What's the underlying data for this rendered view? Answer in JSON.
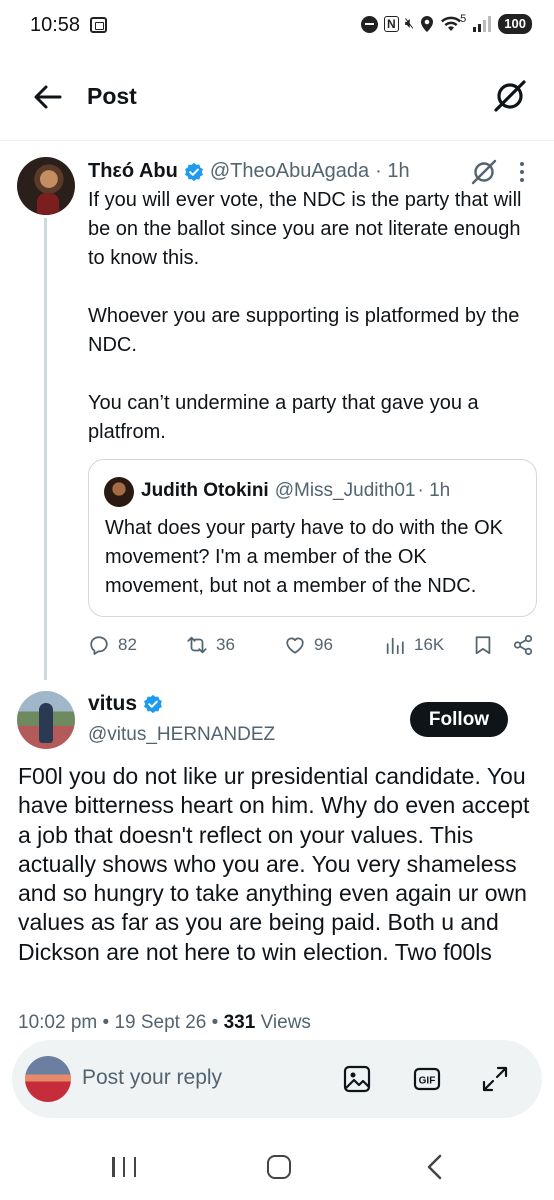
{
  "status_bar": {
    "time": "10:58",
    "network": "5",
    "battery": "100"
  },
  "header": {
    "title": "Post"
  },
  "parent_tweet": {
    "author_name": "Thεó Abu",
    "handle": "@TheoAbuAgada",
    "time": "· 1h",
    "paragraphs": [
      "If you will ever vote, the NDC is the party that will be on the ballot since you are not literate enough to know this.",
      "Whoever you are supporting is platformed by the NDC.",
      "You can’t undermine a party that gave you a platfrom."
    ],
    "quote": {
      "author_name": "Judith Otokini",
      "handle": "@Miss_Judith01",
      "time": "· 1h",
      "text": "What does your party have to do with the OK movement? I'm a member of the OK movement, but not a member of the NDC."
    },
    "stats": {
      "replies": "82",
      "reposts": "36",
      "likes": "96",
      "views": "16K"
    }
  },
  "reply": {
    "author_name": "vitus",
    "handle": "@vitus_HERNANDEZ",
    "follow_label": "Follow",
    "text": "F00l you do not like ur presidential candidate. You have bitterness heart on him. Why do even accept a job that doesn't reflect on your values. This actually shows who you are. You very shameless and so hungry to take anything even again ur own values as far as you are being paid. Both u and Dickson are not here to win election. Two f00ls",
    "time": "10:02 pm",
    "date": "19 Sept 26",
    "views_count": "331",
    "views_label": "Views"
  },
  "composer": {
    "placeholder": "Post your reply"
  },
  "colors": {
    "text": "#0f1419",
    "secondary": "#536471",
    "verified": "#1d9bf0",
    "border": "#cfd9de"
  },
  "icons": [
    "back-arrow-icon",
    "grok-icon",
    "verified-badge-icon",
    "more-icon",
    "reply-icon",
    "repost-icon",
    "like-icon",
    "views-icon",
    "bookmark-icon",
    "share-icon",
    "image-icon",
    "gif-icon",
    "expand-icon"
  ]
}
